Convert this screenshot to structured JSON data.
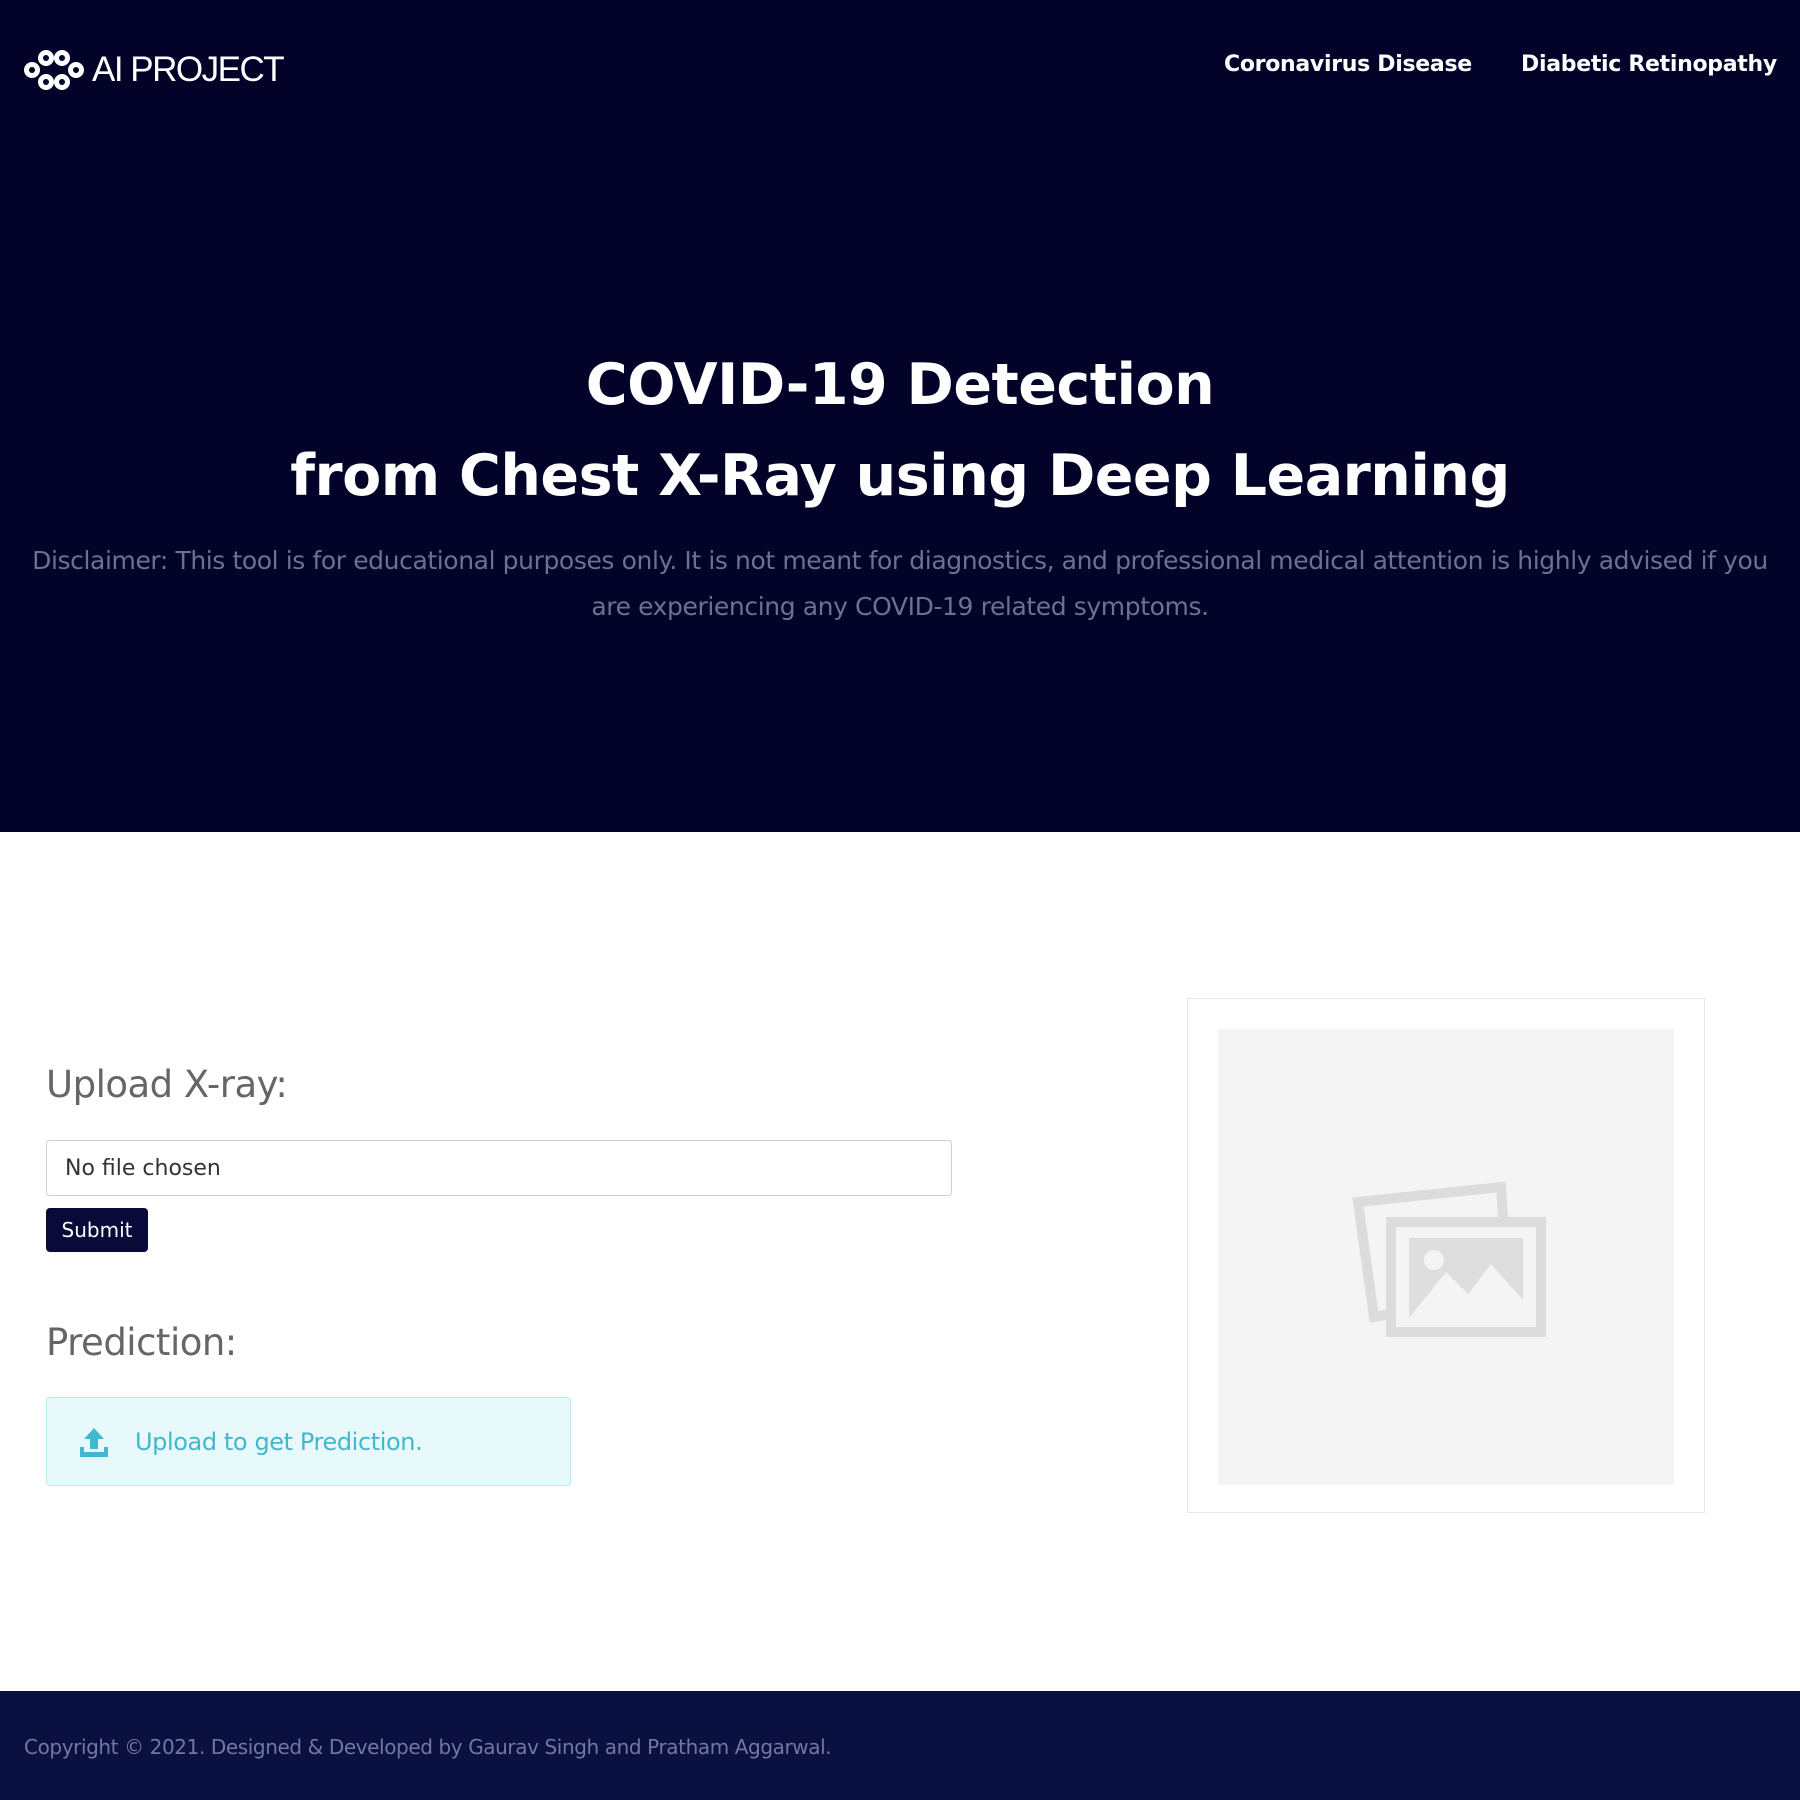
{
  "brand": {
    "text": "AI PROJECT",
    "icon": "molecule-logo-icon"
  },
  "nav": {
    "items": [
      {
        "label": "Coronavirus Disease"
      },
      {
        "label": "Diabetic Retinopathy"
      }
    ]
  },
  "hero": {
    "title_line1_bold": "COVID-19",
    "title_line1_rest": " Detection",
    "title_line2_pre": "from ",
    "title_line2_bold": "Chest X-Ray",
    "title_line2_rest": " using Deep Learning",
    "disclaimer": "Disclaimer: This tool is for educational purposes only. It is not meant for diagnostics, and professional medical attention is highly advised if you are experiencing any COVID-19 related symptoms."
  },
  "upload": {
    "heading": "Upload X-ray:",
    "file_status": "No file chosen",
    "submit_label": "Submit"
  },
  "prediction": {
    "heading": "Prediction:",
    "message": "Upload to get Prediction.",
    "icon": "upload-icon"
  },
  "preview": {
    "icon": "image-placeholder-icon"
  },
  "footer": {
    "text": "Copyright © 2021. Designed & Developed by Gaurav Singh and Pratham Aggarwal."
  },
  "colors": {
    "hero_bg": "#03032a",
    "footer_bg": "#0a1140",
    "button_bg": "#0a0a3a",
    "alert_bg": "#e8f9fc",
    "alert_text": "#43b7cf"
  }
}
